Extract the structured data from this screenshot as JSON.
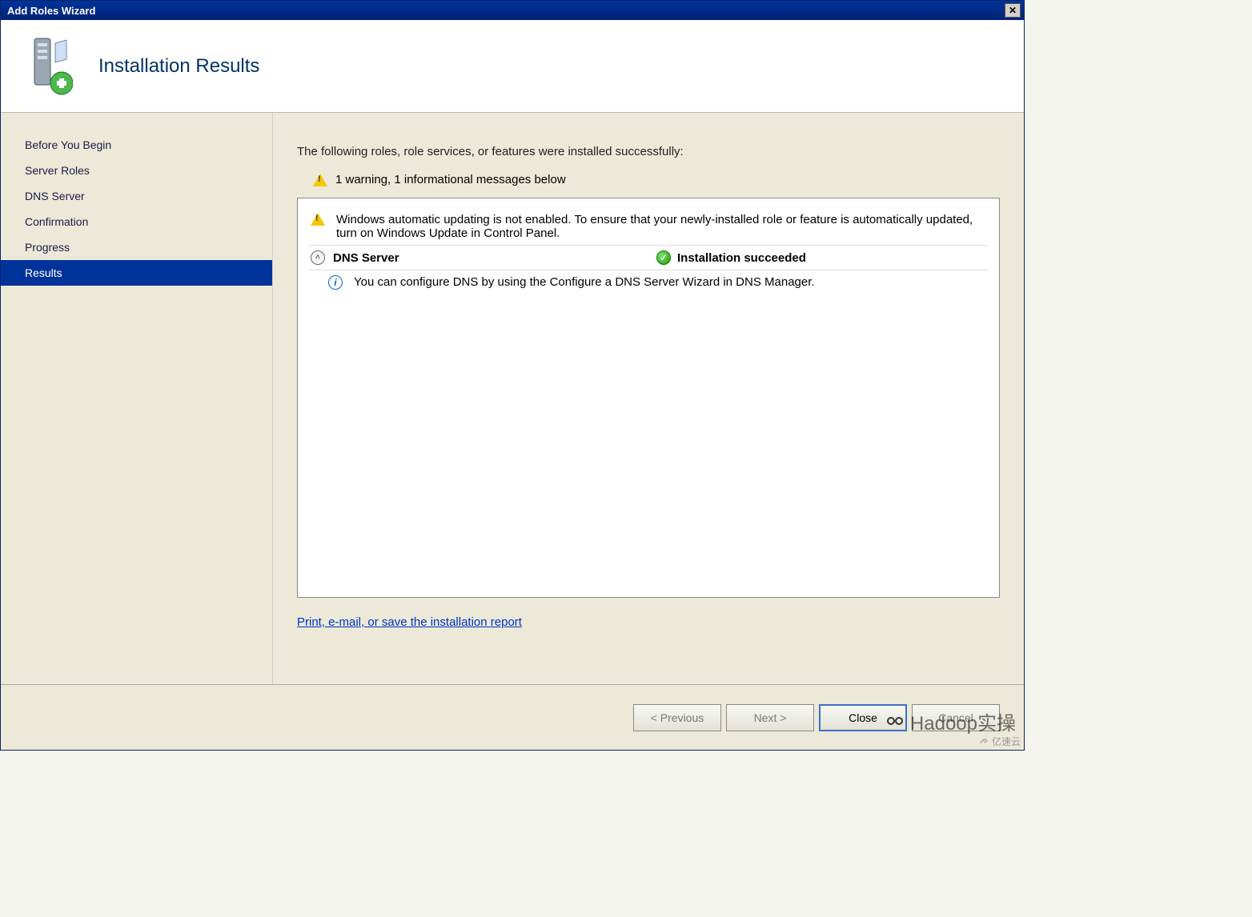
{
  "window": {
    "title": "Add Roles Wizard"
  },
  "header": {
    "title": "Installation Results"
  },
  "sidebar": {
    "steps": [
      {
        "label": "Before You Begin",
        "active": false
      },
      {
        "label": "Server Roles",
        "active": false
      },
      {
        "label": "DNS Server",
        "active": false
      },
      {
        "label": "Confirmation",
        "active": false
      },
      {
        "label": "Progress",
        "active": false
      },
      {
        "label": "Results",
        "active": true
      }
    ]
  },
  "main": {
    "intro": "The following roles, role services, or features were installed successfully:",
    "summary": "1 warning, 1 informational messages below",
    "panel": {
      "warning": "Windows automatic updating is not enabled. To ensure that your newly-installed role or feature is automatically updated, turn on Windows Update in Control Panel.",
      "role": {
        "name": "DNS Server",
        "status": "Installation succeeded"
      },
      "info": "You can configure DNS by using the Configure a DNS Server Wizard in DNS Manager."
    },
    "link": "Print, e-mail, or save the installation report"
  },
  "footer": {
    "previous": "< Previous",
    "next": "Next >",
    "close": "Close",
    "cancel": "Cancel"
  },
  "watermark": {
    "text": "Hadoop实操"
  },
  "cornerbadge": {
    "text": "亿速云"
  }
}
